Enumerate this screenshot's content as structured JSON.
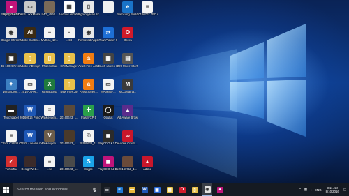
{
  "desktop": {
    "icons": [
      {
        "label": "Recycle Bin",
        "icon": "recycle-bin-icon",
        "color": "#9bb8d6",
        "glyph": "🗑"
      },
      {
        "label": "USB LockMaster",
        "icon": "usb-icon",
        "color": "#c9c9c9",
        "glyph": "▭"
      },
      {
        "label": "IMG_4560...",
        "icon": "photo-icon",
        "color": "#7a6a58",
        "glyph": ""
      },
      {
        "label": "Android and iOS QRcode",
        "icon": "qr-icon",
        "color": "#ffffff",
        "glyph": "▦"
      },
      {
        "label": "logo cityscan.zip",
        "icon": "zip-icon",
        "color": "#e8e8e8",
        "glyph": "▯"
      },
      {
        "label": "...",
        "icon": "file-icon",
        "color": "#f0f0f0",
        "glyph": ""
      },
      {
        "label": "Samsung Printer Di...",
        "icon": "printer-icon",
        "color": "#1a73c8",
        "glyph": "e"
      },
      {
        "label": "20160707 TED Conv...",
        "icon": "document-icon",
        "color": "#f4f4f4",
        "glyph": "≡"
      },
      {
        "label": "PlayCDG KJ Deluxe KJ LT",
        "icon": "playcdg-icon",
        "color": "#c0147a",
        "glyph": "●"
      },
      {
        "label": "Google Chrome",
        "icon": "chrome-icon",
        "color": "#e8e8e8",
        "glyph": "◉"
      },
      {
        "label": "Adobe Illustrat...",
        "icon": "illustrator-icon",
        "color": "#3b2a12",
        "glyph": "Ai"
      },
      {
        "label": "MVDoc_12...",
        "icon": "document-icon",
        "color": "#f4f4f4",
        "glyph": "≡"
      },
      {
        "label": "...txt",
        "icon": "text-file-icon",
        "color": "#f4f4f4",
        "glyph": "≡"
      },
      {
        "label": "Removed Apps.html",
        "icon": "chrome-icon",
        "color": "#e8e8e8",
        "glyph": "◉"
      },
      {
        "label": "TeamViewer 9",
        "icon": "teamviewer-icon",
        "color": "#1d6fd6",
        "glyph": "⇄"
      },
      {
        "label": "Opera",
        "icon": "opera-icon",
        "color": "#d11a2a",
        "glyph": "O"
      },
      {
        "label": "3K 100 X Premier",
        "icon": "app-icon",
        "color": "#2b2b2b",
        "glyph": "▣"
      },
      {
        "label": "Adobe InDesign CS6",
        "icon": "indesign-icon",
        "color": "#e8c04a",
        "glyph": "▯"
      },
      {
        "label": "PhoenixSuit",
        "icon": "phoenix-icon",
        "color": "#e8c04a",
        "glyph": "▯"
      },
      {
        "label": "EPSManager",
        "icon": "folder-icon",
        "color": "#e8c04a",
        "glyph": "▯"
      },
      {
        "label": "Avast Free Antivirus",
        "icon": "avast-icon",
        "color": "#f07c12",
        "glyph": "a"
      },
      {
        "label": "Touch screen keyboard a...",
        "icon": "keyboard-icon",
        "color": "#444444",
        "glyph": "▦"
      },
      {
        "label": "DKI Mixer Interface...",
        "icon": "mixer-icon",
        "color": "#555555",
        "glyph": "▤"
      },
      {
        "label": "Win32Disk...",
        "icon": "satellite-icon",
        "color": "#3c7fc2",
        "glyph": "✦"
      },
      {
        "label": "2016-04-06...",
        "icon": "document-icon",
        "color": "#f4f4f4",
        "glyph": "▭"
      },
      {
        "label": "songlist.xlsx",
        "icon": "excel-icon",
        "color": "#1f7a3e",
        "glyph": "X"
      },
      {
        "label": "New Files.zip",
        "icon": "zip-icon",
        "color": "#e8c04a",
        "glyph": "▯"
      },
      {
        "label": "Avast SafeZ...",
        "icon": "avast-icon",
        "color": "#f07c12",
        "glyph": "a"
      },
      {
        "label": "MA09867...",
        "icon": "file-icon",
        "color": "#f4f4f4",
        "glyph": "▭"
      },
      {
        "label": "MCGMama...",
        "icon": "mcg-icon",
        "color": "#3a3a3a",
        "glyph": "M"
      },
      {
        "label": "TouchLabel",
        "icon": "app-icon",
        "color": "#222222",
        "glyph": "▬"
      },
      {
        "label": "20160516 Princess ...",
        "icon": "word-icon",
        "color": "#1e57b5",
        "glyph": "W"
      },
      {
        "label": "WinKeygen...",
        "icon": "document-icon",
        "color": "#f4f4f4",
        "glyph": "≡"
      },
      {
        "label": "20160623_1...",
        "icon": "photo-icon",
        "color": "#5a4a3a",
        "glyph": ""
      },
      {
        "label": "FlashFXP 5",
        "icon": "flashfxp-icon",
        "color": "#2aa04a",
        "glyph": "✚"
      },
      {
        "label": "Oculus",
        "icon": "oculus-icon",
        "color": "#1a1a1a",
        "glyph": "◯"
      },
      {
        "label": "Ad-Aware Browser",
        "icon": "adaware-icon",
        "color": "#5a2c8c",
        "glyph": "▲"
      },
      {
        "label": "CAVS CSRSI Client",
        "icon": "document-icon",
        "color": "#f4f4f4",
        "glyph": "≡"
      },
      {
        "label": "CAVS - dealer application...",
        "icon": "word-icon",
        "color": "#1e57b5",
        "glyph": "W"
      },
      {
        "label": "WinKeygen...",
        "icon": "photo-icon",
        "color": "#6b5c4a",
        "glyph": "V"
      },
      {
        "label": "20160623_1...",
        "icon": "photo-icon",
        "color": "#4a3a2a",
        "glyph": ""
      },
      {
        "label": "20160622_1...",
        "icon": "document-icon",
        "color": "#f4f4f4",
        "glyph": "©"
      },
      {
        "label": "PlayCDG KJ Deluxe",
        "icon": "playcdg-icon",
        "color": "#2b2b2b",
        "glyph": "◼"
      },
      {
        "label": "Adobe Creati...",
        "icon": "creative-cloud-icon",
        "color": "#c8162b",
        "glyph": "∞"
      },
      {
        "label": "TurboTax",
        "icon": "turbotax-icon",
        "color": "#d32f2f",
        "glyph": "✓"
      },
      {
        "label": "DesignWeb...",
        "icon": "photo-icon",
        "color": "#3a2a2a",
        "glyph": ""
      },
      {
        "label": "...txt",
        "icon": "text-file-icon",
        "color": "#f4f4f4",
        "glyph": "≡"
      },
      {
        "label": "20160623_1...",
        "icon": "photo-icon",
        "color": "#4a4a4a",
        "glyph": ""
      },
      {
        "label": "Skype",
        "icon": "skype-icon",
        "color": "#1aa3e8",
        "glyph": "S"
      },
      {
        "label": "PlayCDG KJ Deluxe",
        "icon": "playcdg-icon",
        "color": "#c0147a",
        "glyph": "◼"
      },
      {
        "label": "20160711_1...",
        "icon": "photo-icon",
        "color": "#6a4a3a",
        "glyph": ""
      },
      {
        "label": "Adobe",
        "icon": "adobe-icon",
        "color": "#c8162b",
        "glyph": "▲"
      }
    ]
  },
  "taskbar": {
    "search_placeholder": "Search the web and Windows",
    "apps": [
      {
        "icon": "task-view-icon",
        "color": "#2a2e36",
        "glyph": "▭"
      },
      {
        "icon": "edge-icon",
        "color": "#1e78d2",
        "glyph": "e"
      },
      {
        "icon": "file-explorer-icon",
        "color": "#e8b83a",
        "glyph": "▬"
      },
      {
        "icon": "word-icon",
        "color": "#1e57b5",
        "glyph": "W"
      },
      {
        "icon": "store-icon",
        "color": "#2a6ad6",
        "glyph": "▣"
      },
      {
        "icon": "notes-icon",
        "color": "#e8c54a",
        "glyph": "▤"
      },
      {
        "icon": "opera-icon",
        "color": "#d11a2a",
        "glyph": "O"
      },
      {
        "icon": "settings-icon",
        "color": "#e8c04a",
        "glyph": "▯"
      },
      {
        "icon": "chrome-icon",
        "color": "#e0e0e0",
        "glyph": "◉"
      },
      {
        "icon": "playcdg-icon",
        "color": "#c0147a",
        "glyph": "●"
      }
    ],
    "tray": {
      "language": "ENG",
      "time": "3:11 AM",
      "date": "8/10/2016"
    }
  }
}
